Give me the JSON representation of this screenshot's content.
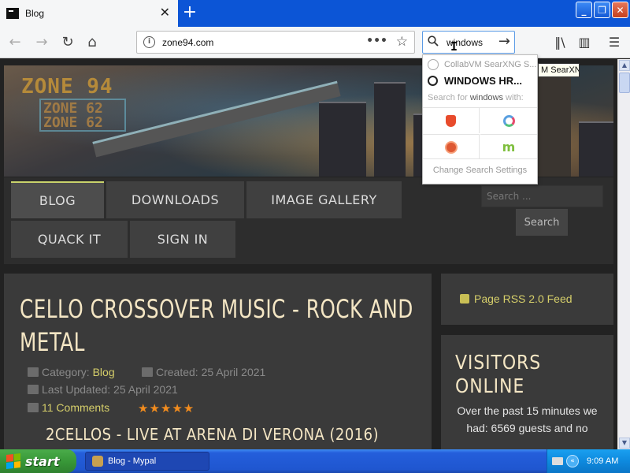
{
  "browser": {
    "tab_title": "Blog",
    "new_tab_symbol": "+",
    "url": "zone94.com",
    "search_value": "windows",
    "window_buttons": [
      "_",
      "❐",
      "✕"
    ]
  },
  "search_popup": {
    "engine_suggestion": "CollabVM SearXNG S...",
    "history_item": "WINDOWS HR...",
    "hint_prefix": "Search for ",
    "hint_term": "windows",
    "hint_suffix": " with:",
    "engines": [
      "brave-icon",
      "qwant-icon",
      "duckduckgo-icon",
      "mojeek-icon"
    ],
    "settings_label": "Change Search Settings",
    "tooltip": "M SearXNG"
  },
  "site": {
    "logo_main": "ZONE 94",
    "logo_sub1": "ZONE 62",
    "logo_sub2": "ZONE 62",
    "menu": [
      "BLOG",
      "DOWNLOADS",
      "IMAGE GALLERY",
      "QUACK IT",
      "SIGN IN"
    ],
    "search_placeholder": "Search ...",
    "search_button": "Search"
  },
  "article": {
    "title": "CELLO CROSSOVER MUSIC - ROCK AND METAL",
    "category_label": "Category: ",
    "category_value": "Blog",
    "created": "Created: 25 April 2021",
    "updated": "Last Updated: 25 April 2021",
    "comments": "11 Comments",
    "rating_stars": "★★★★★",
    "rating": 5,
    "subtitle": "2CELLOS - LIVE AT ARENA DI VERONA (2016)"
  },
  "sidebar": {
    "rss_label": "Page RSS 2.0 Feed",
    "visitors_title": "VISITORS ONLINE",
    "visitors_text": "Over the past 15 minutes we had: 6569 guests and no"
  },
  "taskbar": {
    "start_label": "start",
    "task_title": "Blog - Mypal",
    "tray_arrow": "«",
    "time": "9:09 AM"
  },
  "colors": {
    "xp_taskbar": "#245edb",
    "start_green": "#389838",
    "accent_text": "#d6cf6a",
    "title_text": "#f4e6c4",
    "stars": "#f28c1e"
  }
}
